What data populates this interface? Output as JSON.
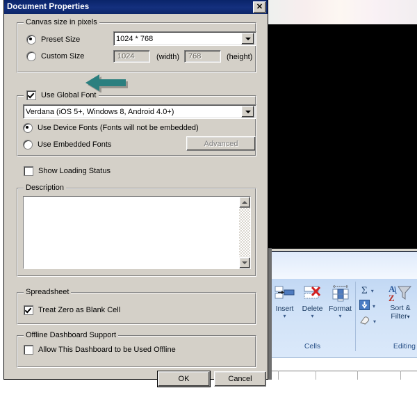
{
  "dialog": {
    "title": "Document Properties",
    "close_label": "✕",
    "groups": {
      "canvas": {
        "title": "Canvas size in pixels",
        "preset_radio_label": "Preset Size",
        "preset_value": "1024 * 768",
        "custom_radio_label": "Custom Size",
        "custom_width_value": "1024",
        "custom_width_unit": "(width)",
        "custom_height_value": "768",
        "custom_height_unit": "(height)"
      },
      "font": {
        "use_global_font_label": "Use Global Font",
        "font_value": "Verdana (iOS 5+, Windows 8, Android 4.0+)",
        "device_fonts_label": "Use Device Fonts (Fonts will not be embedded)",
        "embedded_fonts_label": "Use Embedded Fonts",
        "advanced_button": "Advanced"
      },
      "loading": {
        "show_loading_status_label": "Show Loading Status"
      },
      "description": {
        "title": "Description",
        "value": ""
      },
      "spreadsheet": {
        "title": "Spreadsheet",
        "treat_zero_label": "Treat Zero as Blank Cell"
      },
      "offline": {
        "title": "Offline Dashboard Support",
        "allow_offline_label": "Allow This Dashboard to be Used Offline"
      }
    },
    "buttons": {
      "ok": "OK",
      "cancel": "Cancel"
    }
  },
  "background_app": {
    "ribbon": {
      "groups": [
        {
          "name": "Cells",
          "label": "Cells",
          "buttons": [
            {
              "label": "Insert",
              "caret": "▾"
            },
            {
              "label": "Delete",
              "caret": "▾"
            },
            {
              "label": "Format",
              "caret": "▾"
            }
          ]
        },
        {
          "name": "Editing",
          "label": "Editing",
          "autosum": "Σ",
          "sort_filter_line1": "Sort &",
          "sort_filter_line2": "Filter",
          "sort_filter_caret": "▾",
          "sort_a": "A",
          "sort_z": "Z"
        }
      ]
    }
  },
  "annotation": {
    "arrow_color": "#2b7f7f",
    "arrow_direction": "left",
    "points_at": "Use Global Font"
  }
}
